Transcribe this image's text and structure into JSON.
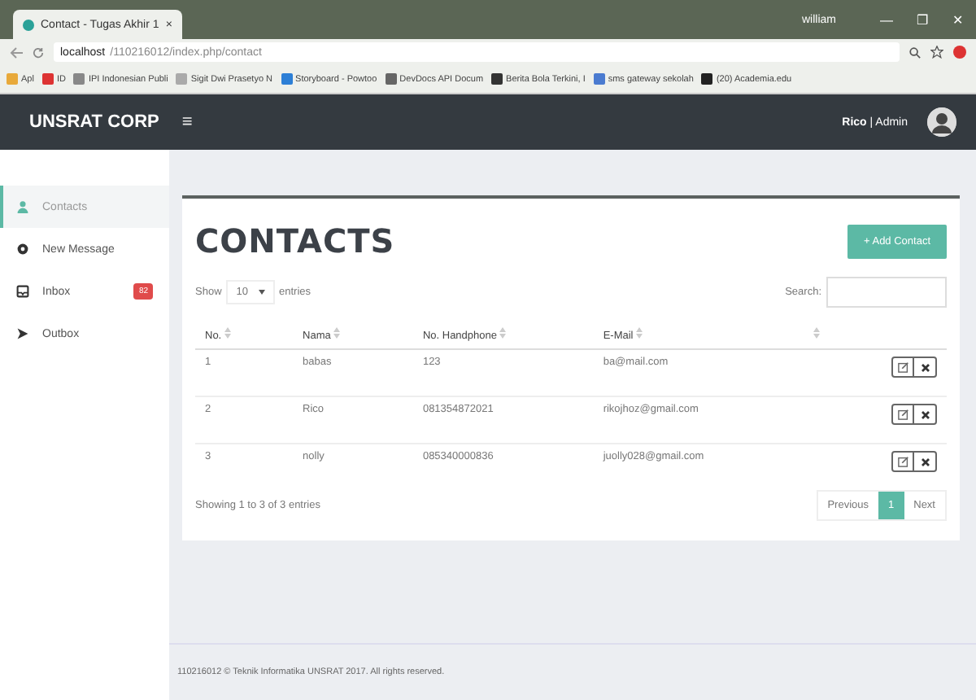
{
  "browser": {
    "tab_title": "Contact - Tugas Akhir 1",
    "tab_close": "×",
    "user": "william",
    "window_controls": [
      "—",
      "❐",
      "✕"
    ],
    "url_host": "localhost",
    "url_path": "/110216012/index.php/contact",
    "bookmarks": [
      {
        "label": "Apl"
      },
      {
        "label": "ID"
      },
      {
        "label": "IPI Indonesian Publi"
      },
      {
        "label": "Sigit Dwi Prasetyo N"
      },
      {
        "label": "Storyboard - Powtoo"
      },
      {
        "label": "DevDocs API Docum"
      },
      {
        "label": "Berita Bola Terkini, I"
      },
      {
        "label": "sms gateway sekolah"
      },
      {
        "label": "(20) Academia.edu"
      }
    ]
  },
  "header": {
    "brand": "UNSRAT CORP",
    "menu_glyph": "≡",
    "user_label": "**Rico** | Admin"
  },
  "sidebar": {
    "items": [
      {
        "label": "Contacts",
        "selected": true
      },
      {
        "label": "New Message",
        "selected": false
      },
      {
        "label": "Inbox",
        "selected": false,
        "badge": "82"
      },
      {
        "label": "Outbox",
        "selected": false
      }
    ]
  },
  "page": {
    "title": "CONTACTS",
    "add_button": "+ Add Contact",
    "show_label": "Show",
    "page_size": "10",
    "entries_label": "entries",
    "search_label": "Search:",
    "table": {
      "columns": [
        "No.",
        "Nama",
        "No. Handphone",
        "E-Mail"
      ],
      "rows": [
        {
          "no": "1",
          "nama": "babas",
          "phone": "123",
          "email": "ba@mail.com"
        },
        {
          "no": "2",
          "nama": "Rico",
          "phone": "081354872021",
          "email": "rikojhoz@gmail.com"
        },
        {
          "no": "3",
          "nama": "nolly",
          "phone": "085340000836",
          "email": "juolly028@gmail.com"
        }
      ]
    },
    "info": "Showing 1 to 3 of 3 entries",
    "pagination": [
      {
        "label": "Previous",
        "selected": false
      },
      {
        "label": "1",
        "selected": true
      },
      {
        "label": "Next",
        "selected": false
      }
    ]
  },
  "footer": "110216012 © Teknik Informatika UNSRAT 2017. All rights reserved."
}
